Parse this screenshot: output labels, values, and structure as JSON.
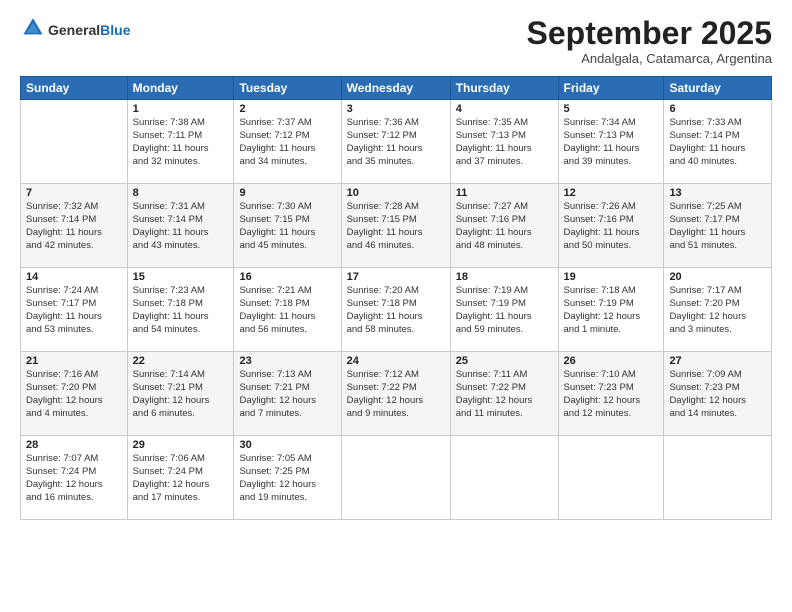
{
  "logo": {
    "general": "General",
    "blue": "Blue"
  },
  "header": {
    "month": "September 2025",
    "location": "Andalgala, Catamarca, Argentina"
  },
  "days_of_week": [
    "Sunday",
    "Monday",
    "Tuesday",
    "Wednesday",
    "Thursday",
    "Friday",
    "Saturday"
  ],
  "weeks": [
    [
      {
        "day": "",
        "info": ""
      },
      {
        "day": "1",
        "info": "Sunrise: 7:38 AM\nSunset: 7:11 PM\nDaylight: 11 hours\nand 32 minutes."
      },
      {
        "day": "2",
        "info": "Sunrise: 7:37 AM\nSunset: 7:12 PM\nDaylight: 11 hours\nand 34 minutes."
      },
      {
        "day": "3",
        "info": "Sunrise: 7:36 AM\nSunset: 7:12 PM\nDaylight: 11 hours\nand 35 minutes."
      },
      {
        "day": "4",
        "info": "Sunrise: 7:35 AM\nSunset: 7:13 PM\nDaylight: 11 hours\nand 37 minutes."
      },
      {
        "day": "5",
        "info": "Sunrise: 7:34 AM\nSunset: 7:13 PM\nDaylight: 11 hours\nand 39 minutes."
      },
      {
        "day": "6",
        "info": "Sunrise: 7:33 AM\nSunset: 7:14 PM\nDaylight: 11 hours\nand 40 minutes."
      }
    ],
    [
      {
        "day": "7",
        "info": "Sunrise: 7:32 AM\nSunset: 7:14 PM\nDaylight: 11 hours\nand 42 minutes."
      },
      {
        "day": "8",
        "info": "Sunrise: 7:31 AM\nSunset: 7:14 PM\nDaylight: 11 hours\nand 43 minutes."
      },
      {
        "day": "9",
        "info": "Sunrise: 7:30 AM\nSunset: 7:15 PM\nDaylight: 11 hours\nand 45 minutes."
      },
      {
        "day": "10",
        "info": "Sunrise: 7:28 AM\nSunset: 7:15 PM\nDaylight: 11 hours\nand 46 minutes."
      },
      {
        "day": "11",
        "info": "Sunrise: 7:27 AM\nSunset: 7:16 PM\nDaylight: 11 hours\nand 48 minutes."
      },
      {
        "day": "12",
        "info": "Sunrise: 7:26 AM\nSunset: 7:16 PM\nDaylight: 11 hours\nand 50 minutes."
      },
      {
        "day": "13",
        "info": "Sunrise: 7:25 AM\nSunset: 7:17 PM\nDaylight: 11 hours\nand 51 minutes."
      }
    ],
    [
      {
        "day": "14",
        "info": "Sunrise: 7:24 AM\nSunset: 7:17 PM\nDaylight: 11 hours\nand 53 minutes."
      },
      {
        "day": "15",
        "info": "Sunrise: 7:23 AM\nSunset: 7:18 PM\nDaylight: 11 hours\nand 54 minutes."
      },
      {
        "day": "16",
        "info": "Sunrise: 7:21 AM\nSunset: 7:18 PM\nDaylight: 11 hours\nand 56 minutes."
      },
      {
        "day": "17",
        "info": "Sunrise: 7:20 AM\nSunset: 7:18 PM\nDaylight: 11 hours\nand 58 minutes."
      },
      {
        "day": "18",
        "info": "Sunrise: 7:19 AM\nSunset: 7:19 PM\nDaylight: 11 hours\nand 59 minutes."
      },
      {
        "day": "19",
        "info": "Sunrise: 7:18 AM\nSunset: 7:19 PM\nDaylight: 12 hours\nand 1 minute."
      },
      {
        "day": "20",
        "info": "Sunrise: 7:17 AM\nSunset: 7:20 PM\nDaylight: 12 hours\nand 3 minutes."
      }
    ],
    [
      {
        "day": "21",
        "info": "Sunrise: 7:16 AM\nSunset: 7:20 PM\nDaylight: 12 hours\nand 4 minutes."
      },
      {
        "day": "22",
        "info": "Sunrise: 7:14 AM\nSunset: 7:21 PM\nDaylight: 12 hours\nand 6 minutes."
      },
      {
        "day": "23",
        "info": "Sunrise: 7:13 AM\nSunset: 7:21 PM\nDaylight: 12 hours\nand 7 minutes."
      },
      {
        "day": "24",
        "info": "Sunrise: 7:12 AM\nSunset: 7:22 PM\nDaylight: 12 hours\nand 9 minutes."
      },
      {
        "day": "25",
        "info": "Sunrise: 7:11 AM\nSunset: 7:22 PM\nDaylight: 12 hours\nand 11 minutes."
      },
      {
        "day": "26",
        "info": "Sunrise: 7:10 AM\nSunset: 7:23 PM\nDaylight: 12 hours\nand 12 minutes."
      },
      {
        "day": "27",
        "info": "Sunrise: 7:09 AM\nSunset: 7:23 PM\nDaylight: 12 hours\nand 14 minutes."
      }
    ],
    [
      {
        "day": "28",
        "info": "Sunrise: 7:07 AM\nSunset: 7:24 PM\nDaylight: 12 hours\nand 16 minutes."
      },
      {
        "day": "29",
        "info": "Sunrise: 7:06 AM\nSunset: 7:24 PM\nDaylight: 12 hours\nand 17 minutes."
      },
      {
        "day": "30",
        "info": "Sunrise: 7:05 AM\nSunset: 7:25 PM\nDaylight: 12 hours\nand 19 minutes."
      },
      {
        "day": "",
        "info": ""
      },
      {
        "day": "",
        "info": ""
      },
      {
        "day": "",
        "info": ""
      },
      {
        "day": "",
        "info": ""
      }
    ]
  ]
}
